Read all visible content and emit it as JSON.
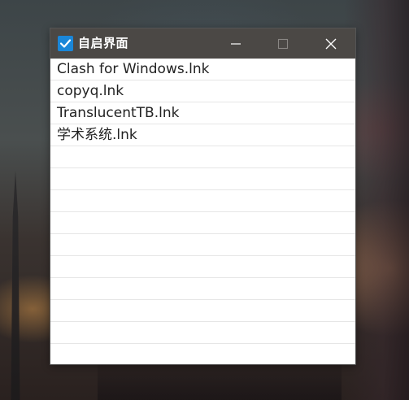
{
  "desktop": {
    "background": "anime-style night wallpaper"
  },
  "window": {
    "title": "自启界面",
    "title_checked": true,
    "colors": {
      "titlebar": "#4b4845",
      "checkbox": "#1a86d8",
      "list_background": "#ffffff",
      "row_divider": "#e6e6e6"
    },
    "controls": {
      "minimize_icon": "minimize-icon",
      "maximize_icon": "maximize-icon",
      "close_icon": "close-icon"
    }
  },
  "list": {
    "items": [
      "Clash for Windows.lnk",
      "copyq.lnk",
      "TranslucentTB.lnk",
      "学术系统.lnk",
      "",
      "",
      "",
      "",
      "",
      "",
      "",
      "",
      "",
      ""
    ]
  }
}
